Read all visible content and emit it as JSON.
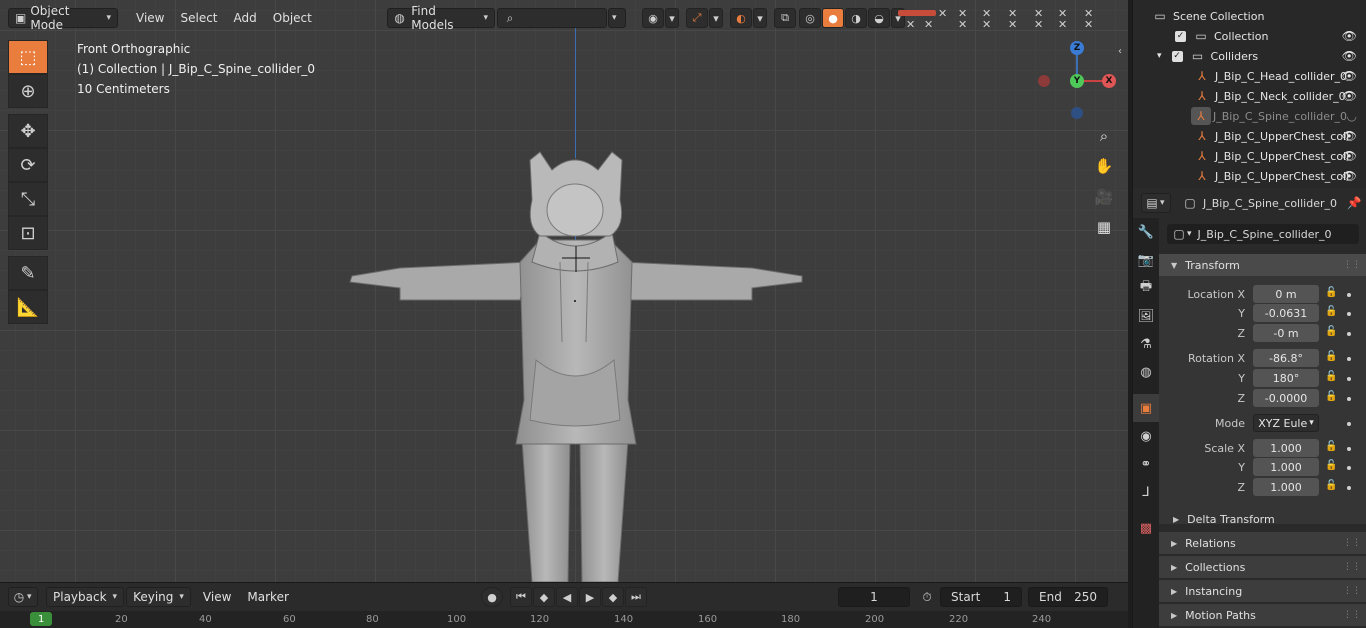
{
  "viewport_header": {
    "mode": "Object Mode",
    "menus": [
      "View",
      "Select",
      "Add",
      "Object"
    ],
    "find_models": "Find Models",
    "search_placeholder": ""
  },
  "viewport_overlay": {
    "view_name": "Front Orthographic",
    "collection_object": "(1) Collection | J_Bip_C_Spine_collider_0",
    "scale": "10 Centimeters"
  },
  "gizmo": {
    "z": "Z",
    "y": "Y",
    "x": "X"
  },
  "timeline": {
    "menus": [
      "Playback",
      "Keying",
      "View",
      "Marker"
    ],
    "current_frame": "1",
    "start_label": "Start",
    "start_value": "1",
    "end_label": "End",
    "end_value": "250",
    "ticks": [
      "1",
      "20",
      "40",
      "60",
      "80",
      "100",
      "120",
      "140",
      "160",
      "180",
      "200",
      "220",
      "240"
    ]
  },
  "outliner": {
    "scene_collection": "Scene Collection",
    "items": [
      {
        "label": "Collection"
      },
      {
        "label": "Colliders"
      },
      {
        "label": "J_Bip_C_Head_collider_0"
      },
      {
        "label": "J_Bip_C_Neck_collider_0"
      },
      {
        "label": "J_Bip_C_Spine_collider_0"
      },
      {
        "label": "J_Bip_C_UpperChest_coll"
      },
      {
        "label": "J_Bip_C_UpperChest_coll"
      },
      {
        "label": "J_Bip_C_UpperChest_coll"
      }
    ]
  },
  "properties": {
    "object_name": "J_Bip_C_Spine_collider_0",
    "object_field": "J_Bip_C_Spine_collider_0",
    "transform_title": "Transform",
    "location_label": "Location X",
    "location": {
      "x": "0 m",
      "y": "-0.0631",
      "z": "-0 m"
    },
    "rotation_label": "Rotation X",
    "rotation": {
      "x": "-86.8°",
      "y": "180°",
      "z": "-0.0000"
    },
    "mode_label": "Mode",
    "mode_value": "XYZ Eule",
    "scale_label": "Scale X",
    "scale": {
      "x": "1.000",
      "y": "1.000",
      "z": "1.000"
    },
    "axis_y": "Y",
    "axis_z": "Z",
    "panels": [
      "Delta Transform",
      "Relations",
      "Collections",
      "Instancing",
      "Motion Paths"
    ]
  }
}
